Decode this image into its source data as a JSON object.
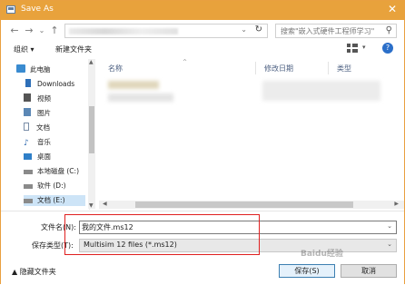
{
  "window": {
    "title": "Save As",
    "close_glyph": "✕"
  },
  "nav_buttons": {
    "back": "←",
    "forward": "→",
    "history": "⌄",
    "up": "↑"
  },
  "address": {
    "dropdown_glyph": "⌄",
    "refresh_glyph": "↻"
  },
  "search": {
    "placeholder": "搜索\"嵌入式硬件工程师学习\"",
    "icon_glyph": "⚲"
  },
  "toolbar": {
    "organize_label": "组织 ▾",
    "new_folder_label": "新建文件夹",
    "view_dropdown": "▾",
    "help_glyph": "?"
  },
  "sidebar": {
    "items": [
      {
        "label": "此电脑",
        "icon": "computer-icon",
        "color": "#3a8bd0"
      },
      {
        "label": "Downloads",
        "icon": "downloads-icon",
        "color": "#2e6fb8"
      },
      {
        "label": "视频",
        "icon": "video-icon",
        "color": "#555555"
      },
      {
        "label": "图片",
        "icon": "pictures-icon",
        "color": "#5b87b5"
      },
      {
        "label": "文档",
        "icon": "documents-icon",
        "color": "#7a8ea8"
      },
      {
        "label": "音乐",
        "icon": "music-icon",
        "color": "#2f6ab0"
      },
      {
        "label": "桌面",
        "icon": "desktop-icon",
        "color": "#2f7fc8"
      },
      {
        "label": "本地磁盘 (C:)",
        "icon": "drive-icon",
        "color": "#8a8a8a"
      },
      {
        "label": "软件 (D:)",
        "icon": "drive-icon",
        "color": "#8a8a8a"
      },
      {
        "label": "文档 (E:)",
        "icon": "drive-icon",
        "color": "#8a8a8a"
      }
    ]
  },
  "file_list": {
    "columns": {
      "name": "名称",
      "modified": "修改日期",
      "type": "类型"
    }
  },
  "filename": {
    "label": "文件名(N):",
    "value": "我的文件.ms12"
  },
  "save_type": {
    "label": "保存类型(T):",
    "value": "Multisim 12 files (*.ms12)"
  },
  "footer": {
    "hide_folders_label": "隐藏文件夹",
    "save_label": "保存(S)",
    "cancel_label": "取消",
    "watermark": "Baidu经验"
  },
  "colors": {
    "titlebar": "#e8a23c",
    "highlight_box": "#e02020",
    "selected_item": "#cde4f7"
  }
}
